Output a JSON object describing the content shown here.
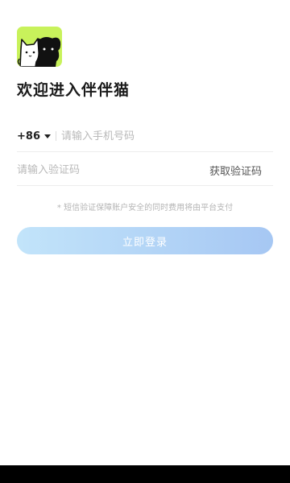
{
  "header": {
    "welcome_text": "欢迎进入伴伴猫"
  },
  "logo": {
    "icon": "cat-and-dog-logo-icon",
    "background_color": "#c8f25b"
  },
  "phone": {
    "country_code": "+86",
    "placeholder": "请输入手机号码",
    "value": ""
  },
  "verification": {
    "placeholder": "请输入验证码",
    "value": "",
    "get_code_label": "获取验证码"
  },
  "notice": "* 短信验证保障账户安全的同时费用将由平台支付",
  "login": {
    "label": "立即登录",
    "gradient_start": "#c2e4fa",
    "gradient_end": "#a6c7f3"
  }
}
